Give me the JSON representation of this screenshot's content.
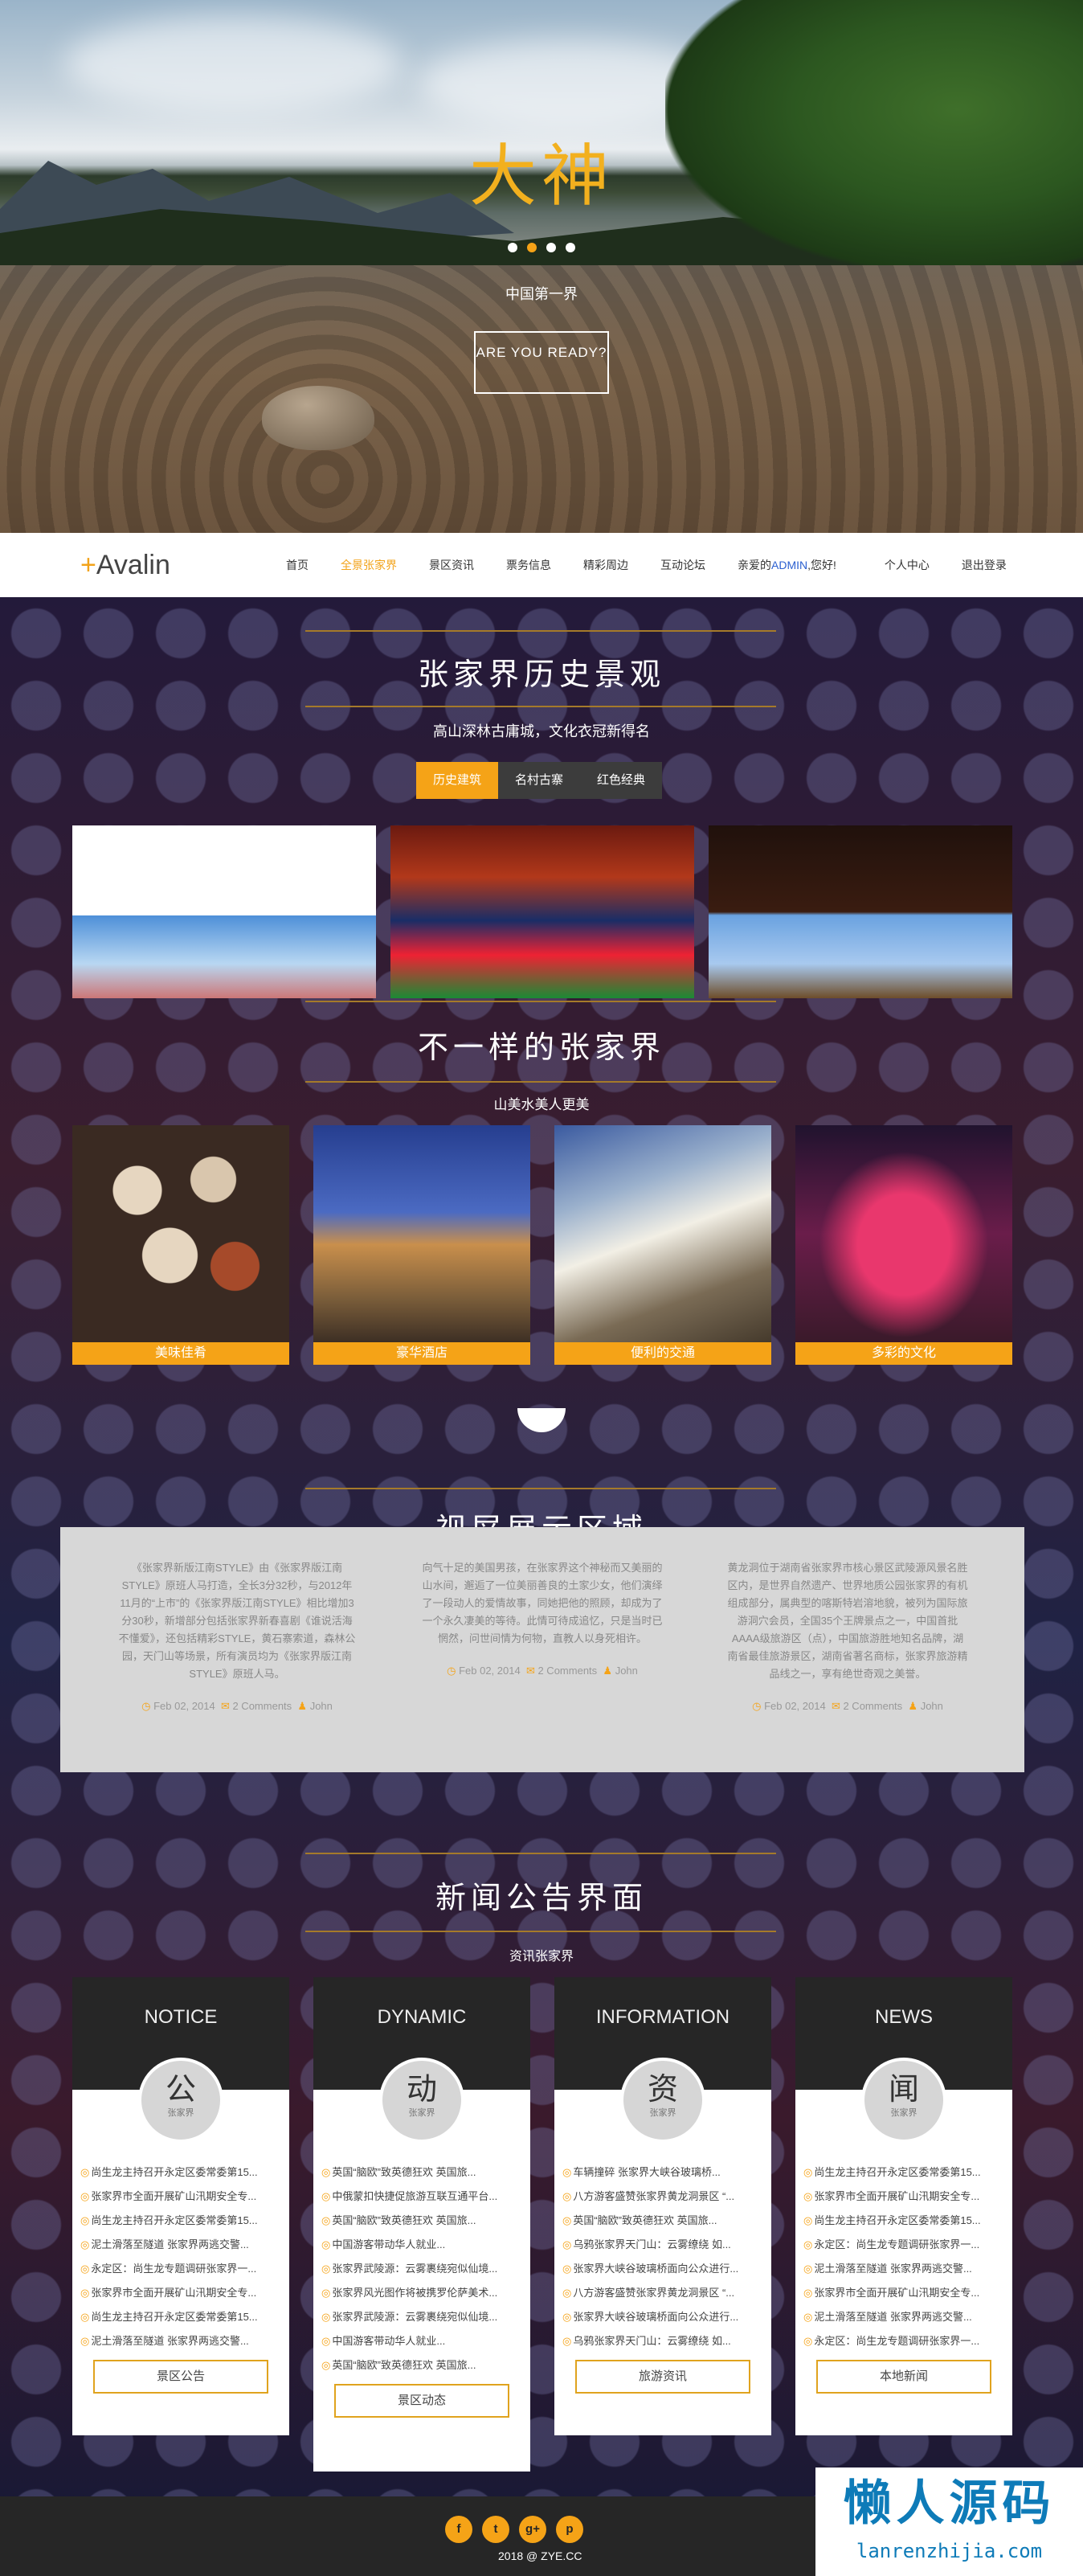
{
  "hero": {
    "title": "大神",
    "subtitle": "中国第一界",
    "button": "ARE YOU READY?"
  },
  "nav": {
    "logo_plus": "+",
    "logo": "Avalin",
    "items": [
      "首页",
      "全景张家界",
      "景区资讯",
      "票务信息",
      "精彩周边",
      "互动论坛"
    ],
    "user_prefix": "亲爱的",
    "user_name": "ADMIN",
    "user_suffix": ",您好!",
    "personal": "个人中心",
    "logout": "退出登录"
  },
  "history": {
    "title": "张家界历史景观",
    "subtitle": "高山深林古庸城，文化衣冠新得名",
    "tabs": [
      "历史建筑",
      "名村古寨",
      "红色经典"
    ]
  },
  "different": {
    "title": "不一样的张家界",
    "subtitle": "山美水美人更美",
    "cards": [
      "美味佳肴",
      "豪华酒店",
      "便利的交通",
      "多彩的文化"
    ]
  },
  "video": {
    "title": "视屏展示区域",
    "cols": [
      {
        "text": "《张家界新版江南STYLE》由《张家界版江南STYLE》原班人马打造，全长3分32秒，与2012年11月的“上市”的《张家界版江南STYLE》相比增加3分30秒，新增部分包括张家界新春喜剧《谁说活海不懂爱》，还包括精彩STYLE，黄石寨索道，森林公园，天门山等场景，所有演员均为《张家界版江南STYLE》原班人马。",
        "date": "Feb 02, 2014",
        "comments": "2 Comments",
        "author": "John"
      },
      {
        "text": "向气十足的美国男孩，在张家界这个神秘而又美丽的山水间，邂逅了一位美丽善良的土家少女，他们演绎了一段动人的爱情故事，同她把他的照顾，却成为了一个永久凄美的等待。此情可待成追忆，只是当时已惘然，问世间情为何物，直教人以身死相许。",
        "date": "Feb 02, 2014",
        "comments": "2 Comments",
        "author": "John"
      },
      {
        "text": "黄龙洞位于湖南省张家界市核心景区武陵源风景名胜区内，是世界自然遗产、世界地质公园张家界的有机组成部分，属典型的喀斯特岩溶地貌，被列为国际旅游洞穴会员，全国35个王牌景点之一，中国首批AAAA级旅游区（点），中国旅游胜地知名品牌，湖南省最佳旅游景区，湖南省著名商标，张家界旅游精品线之一，享有绝世奇观之美誉。",
        "date": "Feb 02, 2014",
        "comments": "2 Comments",
        "author": "John"
      }
    ]
  },
  "news": {
    "title": "新闻公告界面",
    "subtitle": "资讯张家界",
    "boxes": [
      {
        "head": "NOTICE",
        "char": "公",
        "small": "张家界",
        "btn": "景区公告",
        "items": [
          "尚生龙主持召开永定区委常委第15...",
          "张家界市全面开展矿山汛期安全专...",
          "尚生龙主持召开永定区委常委第15...",
          "泥土滑落至隧道 张家界两逃交警...",
          "永定区：尚生龙专题调研张家界一...",
          "张家界市全面开展矿山汛期安全专...",
          "尚生龙主持召开永定区委常委第15...",
          "泥土滑落至隧道 张家界两逃交警..."
        ]
      },
      {
        "head": "DYNAMIC",
        "char": "动",
        "small": "张家界",
        "btn": "景区动态",
        "items": [
          "英国“脑欧”致英德狂欢 英国旅...",
          "中俄蒙扣快捷促旅游互联互通平台...",
          "英国“脑欧”致英德狂欢 英国旅...",
          "中国游客带动华人就业...",
          "张家界武陵源：云雾裹绕宛似仙境...",
          "张家界风光图作将被携罗伦萨美术...",
          "张家界武陵源：云雾裹绕宛似仙境...",
          "中国游客带动华人就业...",
          "英国“脑欧”致英德狂欢 英国旅..."
        ]
      },
      {
        "head": "INFORMATION",
        "char": "资",
        "small": "张家界",
        "btn": "旅游资讯",
        "items": [
          "车辆撞碎 张家界大峡谷玻璃桥...",
          "八方游客盛赞张家界黄龙洞景区 “...",
          "英国“脑欧”致英德狂欢 英国旅...",
          "乌鸦张家界天门山：云雾缭绕 如...",
          "张家界大峡谷玻璃桥面向公众进行...",
          "八方游客盛赞张家界黄龙洞景区 “...",
          "张家界大峡谷玻璃桥面向公众进行...",
          "乌鸦张家界天门山：云雾缭绕 如..."
        ]
      },
      {
        "head": "NEWS",
        "char": "闻",
        "small": "张家界",
        "btn": "本地新闻",
        "items": [
          "尚生龙主持召开永定区委常委第15...",
          "张家界市全面开展矿山汛期安全专...",
          "尚生龙主持召开永定区委常委第15...",
          "永定区：尚生龙专题调研张家界一...",
          "泥土滑落至隧道 张家界两逃交警...",
          "张家界市全面开展矿山汛期安全专...",
          "泥土滑落至隧道 张家界两逃交警...",
          "永定区：尚生龙专题调研张家界一..."
        ]
      }
    ]
  },
  "footer": {
    "socials": [
      "f",
      "t",
      "g+",
      "p"
    ],
    "copy": "2018 @ ZYE.CC"
  },
  "watermark": {
    "title": "懒人源码",
    "url": "lanrenzhijia.com"
  },
  "colors": {
    "accent": "#f5a317",
    "footer": "#262626"
  }
}
